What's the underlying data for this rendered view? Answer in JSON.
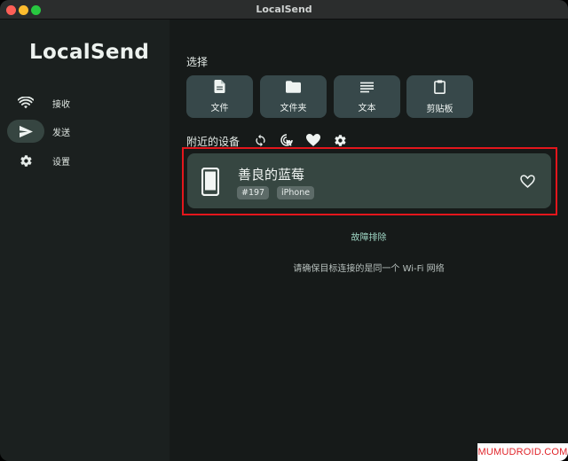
{
  "window": {
    "title": "LocalSend"
  },
  "sidebar": {
    "logo": "LocalSend",
    "items": [
      {
        "label": "接收",
        "icon": "wifi-icon"
      },
      {
        "label": "发送",
        "icon": "send-icon",
        "active": true
      },
      {
        "label": "设置",
        "icon": "gear-icon"
      }
    ]
  },
  "main": {
    "select_label": "选择",
    "tiles": [
      {
        "label": "文件",
        "icon": "file-icon"
      },
      {
        "label": "文件夹",
        "icon": "folder-icon"
      },
      {
        "label": "文本",
        "icon": "text-icon"
      },
      {
        "label": "剪贴板",
        "icon": "clipboard-icon"
      }
    ],
    "nearby_label": "附近的设备",
    "nearby_icons": [
      "refresh-icon",
      "scan-icon",
      "heart-icon",
      "gear-icon"
    ],
    "device": {
      "name": "善良的蓝莓",
      "id_badge": "#197",
      "type_badge": "iPhone",
      "icon": "phone-icon",
      "favorite_icon": "heart-outline-icon"
    },
    "troubleshoot": "故障排除",
    "hint": "请确保目标连接的是同一个 Wi-Fi 网络"
  },
  "watermark": "MUMUDROID.COM",
  "colors": {
    "accent": "#9fd6c4",
    "card": "#364641",
    "tile": "#37484a",
    "highlight": "#e3161c"
  }
}
